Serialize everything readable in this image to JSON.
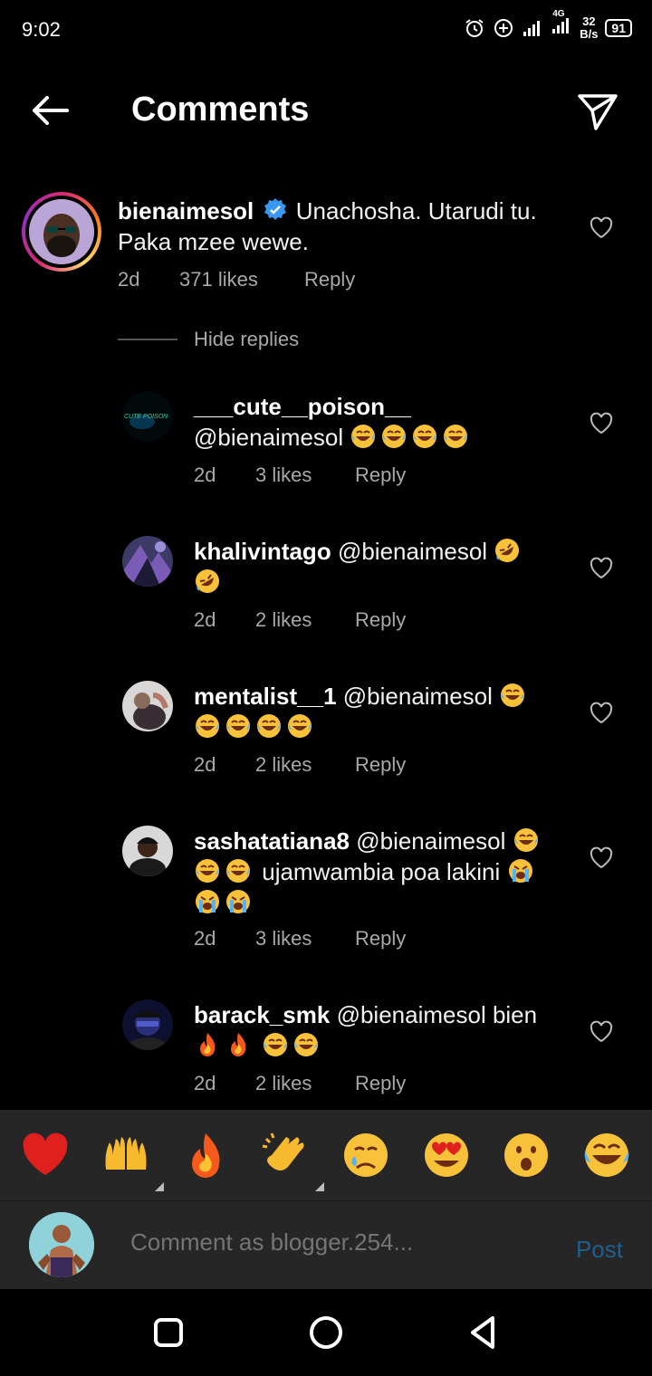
{
  "status_bar": {
    "time": "9:02",
    "network": "4G",
    "speed_value": "32",
    "speed_unit": "B/s",
    "battery": "91"
  },
  "header": {
    "title": "Comments"
  },
  "main_comment": {
    "username": "bienaimesol",
    "text": "Unachosha. Utarudi tu. Paka mzee wewe.",
    "time": "2d",
    "likes": "371 likes",
    "reply_label": "Reply",
    "hide_replies_label": "Hide replies"
  },
  "replies": [
    {
      "username": "___cute__poison__",
      "mention": "@bienaimesol",
      "time": "2d",
      "likes": "3 likes",
      "reply_label": "Reply",
      "avatar_text": "CUTE POISON"
    },
    {
      "username": "khalivintago",
      "mention": "@bienaimesol",
      "time": "2d",
      "likes": "2 likes",
      "reply_label": "Reply"
    },
    {
      "username": "mentalist__1",
      "mention": "@bienaimesol",
      "time": "2d",
      "likes": "2 likes",
      "reply_label": "Reply"
    },
    {
      "username": "sashatatiana8",
      "mention": "@bienaimesol",
      "text_mid": " ujamwambia poa lakini",
      "time": "2d",
      "likes": "3 likes",
      "reply_label": "Reply"
    },
    {
      "username": "barack_smk",
      "mention": "@bienaimesol",
      "text_after": " bien",
      "time": "2d",
      "likes": "2 likes",
      "reply_label": "Reply"
    }
  ],
  "emoji_bar": [
    "red-heart",
    "raising-hands",
    "fire",
    "clapping-hands",
    "crying-face",
    "heart-eyes",
    "open-mouth-face",
    "tears-of-joy"
  ],
  "comment_bar": {
    "placeholder": "Comment as blogger.254...",
    "post_label": "Post"
  },
  "colors": {
    "background": "#000000",
    "bar_background": "#262626",
    "verified_blue": "#3897f0",
    "post_disabled": "#1f5f8e",
    "muted_text": "#a8a8a8"
  }
}
